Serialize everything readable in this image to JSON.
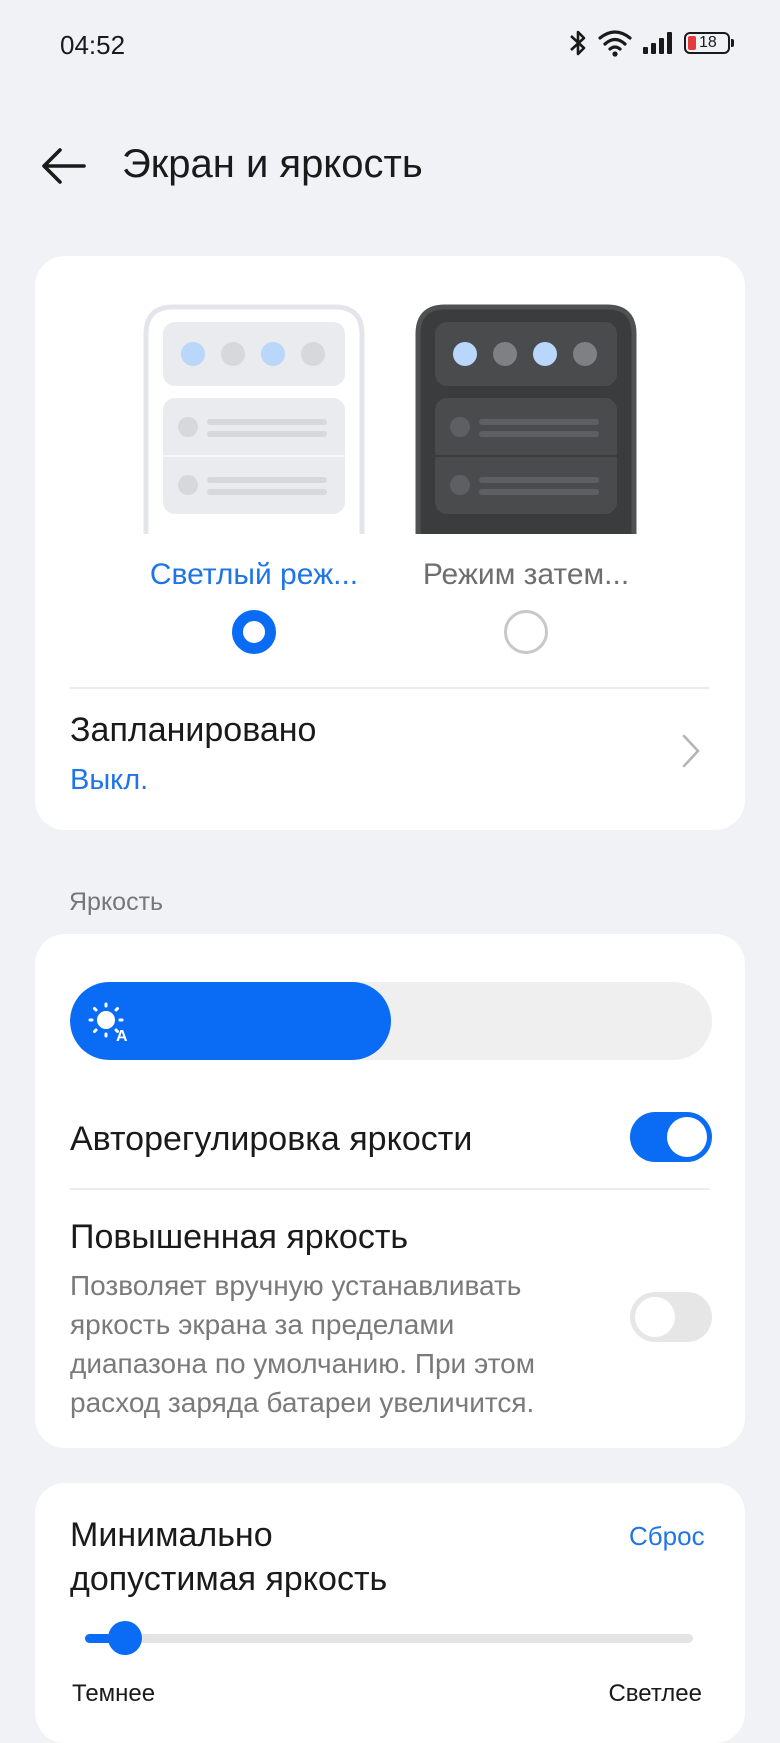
{
  "status_bar": {
    "time": "04:52",
    "battery": "18",
    "icons": [
      "bluetooth-icon",
      "wifi-icon",
      "signal-icon",
      "battery-icon"
    ]
  },
  "header": {
    "title": "Экран и яркость",
    "back_icon": "arrow-left-icon"
  },
  "theme": {
    "light_label": "Светлый реж...",
    "dark_label": "Режим затем...",
    "selected": "light",
    "scheduled_title": "Запланировано",
    "scheduled_value": "Выкл."
  },
  "brightness": {
    "section_label": "Яркость",
    "level": 0.5,
    "auto_icon": "auto-brightness-icon",
    "auto_label": "Авторегулировка яркости",
    "auto_enabled": true,
    "boost_title": "Повышенная яркость",
    "boost_desc_lines": [
      "Позволяет вручную устанавливать",
      "яркость экрана за пределами",
      "диапазона по умолчанию. При этом",
      "расход заряда батареи увеличится."
    ],
    "boost_enabled": false
  },
  "min_brightness": {
    "title_lines": [
      "Минимально",
      "допустимая яркость"
    ],
    "reset_label": "Сброс",
    "level": 0.04,
    "left_label": "Темнее",
    "right_label": "Светлее"
  },
  "colors": {
    "accent": "#0a6cf5",
    "background": "#f1f2f6",
    "card": "#ffffff"
  }
}
